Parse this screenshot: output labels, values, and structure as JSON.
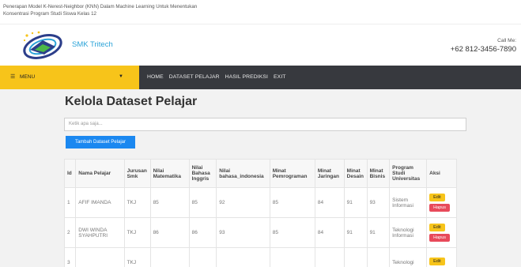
{
  "header": {
    "title_line1": "Penerapan Model K-Nerest-Neighbor (KNN) Dalam Machine Learning Untuk Menentukan",
    "title_line2": "Konsentrasi Program Studi Siswa Kelas 12"
  },
  "brand": {
    "name": "SMK Tritech",
    "call_label": "Call Me:",
    "phone": "+62 812-3456-7890"
  },
  "nav": {
    "menu_label": "MENU",
    "links": [
      "HOME",
      "DATASET PELAJAR",
      "HASIL PREDIKSI",
      "EXIT"
    ]
  },
  "page": {
    "title": "Kelola Dataset Pelajar",
    "search_placeholder": "Ketik apa saja...",
    "add_button": "Tambah Dataset Pelajar"
  },
  "table": {
    "headers": [
      "Id",
      "Nama Pelajar",
      "Jurusan Smk",
      "Nilai Matematika",
      "Nilai Bahasa Inggris",
      "Nilai bahasa_indonesia",
      "Minat Pemrograman",
      "Minat Jaringan",
      "Minat Desain",
      "Minat Bisnis",
      "Program Studi Universitas",
      "Aksi"
    ],
    "rows": [
      [
        "1",
        "AFIF IMANDA",
        "TKJ",
        "85",
        "85",
        "92",
        "85",
        "84",
        "91",
        "93",
        "Sistem Informasi"
      ],
      [
        "2",
        "DWI WINDA SYAHPUTRI",
        "TKJ",
        "86",
        "86",
        "93",
        "85",
        "84",
        "91",
        "91",
        "Teknologi Informasi"
      ],
      [
        "3",
        "",
        "TKJ",
        "",
        "",
        "",
        "",
        "",
        "",
        "",
        "Teknologi"
      ]
    ],
    "edit_label": "Edit",
    "delete_label": "Hapus"
  },
  "colors": {
    "accent_yellow": "#f7c41a",
    "nav_dark": "#37393e",
    "primary_blue": "#1b88f0",
    "danger_red": "#e84a5a"
  }
}
